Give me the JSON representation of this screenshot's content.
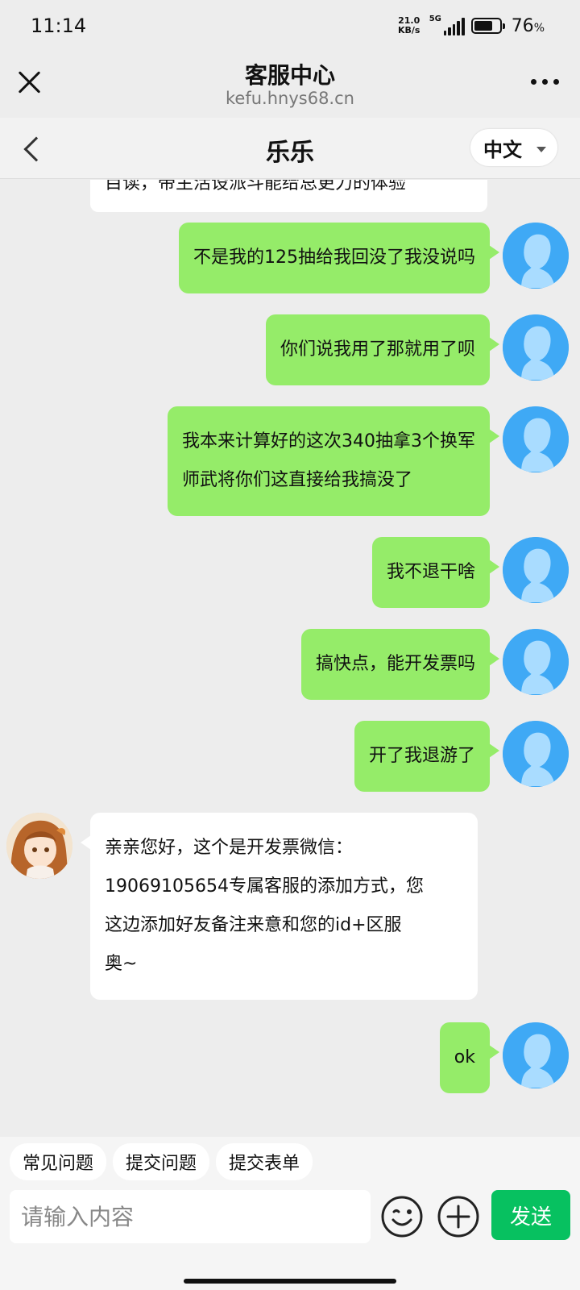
{
  "status_bar": {
    "time": "11:14",
    "net_speed_value": "21.0",
    "net_speed_unit": "KB/s",
    "network": "5G",
    "battery_level": 0.76,
    "battery_pct": "76",
    "battery_pct_suffix": "%"
  },
  "web_header": {
    "title": "客服中心",
    "url": "kefu.hnys68.cn"
  },
  "chat_header": {
    "agent_name": "乐乐",
    "language": "中文"
  },
  "messages": {
    "partial_top": "目读，带主活设派斗能给总更力的体验",
    "m1": "不是我的125抽给我回没了我没说吗",
    "m2": "你们说我用了那就用了呗",
    "m3_line1": "我本来计算好的这次340抽拿3个换军",
    "m3_line2": "师武将你们这直接给我搞没了",
    "m4": "我不退干啥",
    "m5": "搞快点，能开发票吗",
    "m6": "开了我退游了",
    "agent_line1": "亲亲您好，这个是开发票微信：",
    "agent_line2": "19069105654专属客服的添加方式，您",
    "agent_line3": "这边添加好友备注来意和您的id+区服",
    "agent_line4": "奥~",
    "m8": "ok"
  },
  "quick_actions": {
    "faq": "常见问题",
    "submit_issue": "提交问题",
    "submit_form": "提交表单"
  },
  "composer": {
    "placeholder": "请输入内容",
    "send_label": "发送"
  },
  "colors": {
    "my_bubble": "#95ec69",
    "agent_bubble": "#ffffff",
    "send_button": "#07c160",
    "user_avatar": "#3fa9f5"
  }
}
